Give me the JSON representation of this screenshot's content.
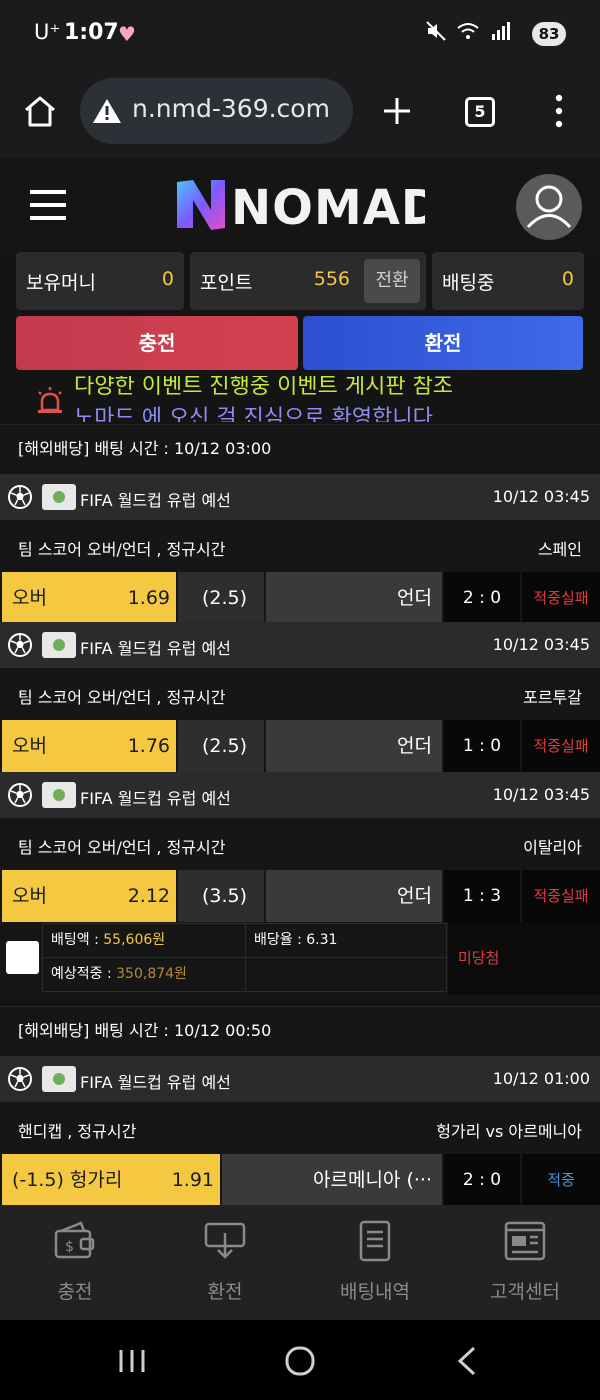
{
  "status_bar": {
    "carrier": "U⁺",
    "time": "1:07",
    "battery": "83"
  },
  "browser": {
    "url": "n.nmd-369.com",
    "tab_count": "5"
  },
  "site": {
    "logo_text": "NOMAD"
  },
  "balances": [
    {
      "label": "보유머니",
      "value": "0"
    },
    {
      "label": "포인트",
      "value": "556",
      "action": "전환"
    },
    {
      "label": "배팅중",
      "value": "0"
    }
  ],
  "actions": {
    "deposit": "충전",
    "withdraw": "환전"
  },
  "notice": {
    "line1": "다양한 이벤트 진행중 이벤트 게시판 참조",
    "line2": "노마드 에 오신 걸 진심으로 환영합니다"
  },
  "bet_groups": [
    {
      "title": "[해외배당] 배팅 시간 : 10/12 03:00",
      "matches": [
        {
          "league": "FIFA 월드컵 유럽 예선",
          "date": "10/12 03:45",
          "market": "팀 스코어 오버/언더 , 정규시간",
          "team": "스페인",
          "pick": "오버",
          "odds": "1.69",
          "line": "(2.5)",
          "other": "언더",
          "score": "2 : 0",
          "result": "적중실패"
        },
        {
          "league": "FIFA 월드컵 유럽 예선",
          "date": "10/12 03:45",
          "market": "팀 스코어 오버/언더 , 정규시간",
          "team": "포르투갈",
          "pick": "오버",
          "odds": "1.76",
          "line": "(2.5)",
          "other": "언더",
          "score": "1 : 0",
          "result": "적중실패"
        },
        {
          "league": "FIFA 월드컵 유럽 예선",
          "date": "10/12 03:45",
          "market": "팀 스코어 오버/언더 , 정규시간",
          "team": "이탈리아",
          "pick": "오버",
          "odds": "2.12",
          "line": "(3.5)",
          "other": "언더",
          "score": "1 : 3",
          "result": "적중실패"
        }
      ],
      "summary": {
        "bet_amount_label": "배팅액 : ",
        "bet_amount": "55,606원",
        "odds_label": "배당율 : ",
        "odds": "6.31",
        "expected_label": "예상적중 : ",
        "expected": "350,874원",
        "result": "미당첨"
      }
    },
    {
      "title": "[해외배당] 배팅 시간 : 10/12 00:50",
      "matches": [
        {
          "league": "FIFA 월드컵 유럽 예선",
          "date": "10/12 01:00",
          "market": "핸디캡 , 정규시간",
          "team": "헝가리  vs  아르메니아",
          "pick": "(-1.5) 헝가리",
          "odds": "1.91",
          "other": "아르메니아 (···",
          "score": "2 : 0",
          "result": "적중"
        }
      ]
    }
  ],
  "bottom_nav": [
    {
      "label": "충전",
      "icon": "wallet-icon"
    },
    {
      "label": "환전",
      "icon": "cash-out-icon"
    },
    {
      "label": "배팅내역",
      "icon": "document-icon"
    },
    {
      "label": "고객센터",
      "icon": "newspaper-icon"
    }
  ],
  "colors": {
    "accent_yellow": "#f5c842",
    "fail_red": "#e23b3b",
    "win_blue": "#4a8fd8",
    "deposit_red": "#c93a4e",
    "withdraw_blue": "#3357d6"
  }
}
